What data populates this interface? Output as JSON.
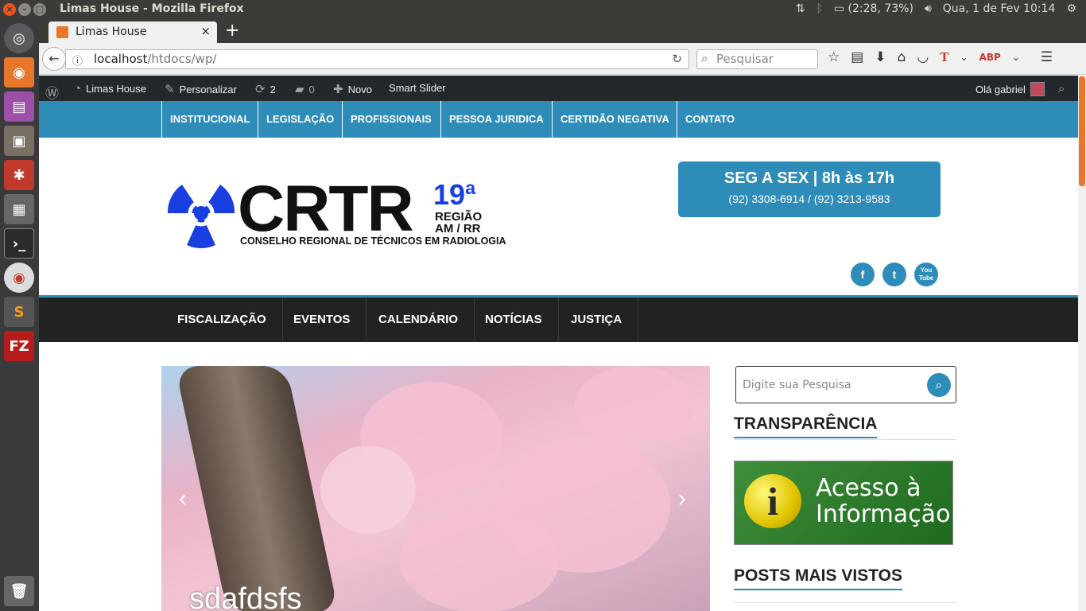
{
  "os": {
    "window_title": "Limas House - Mozilla Firefox",
    "battery": "(2:28, 73%)",
    "datetime": "Qua,  1 de Fev 10:14"
  },
  "browser": {
    "tab_title": "Limas House",
    "url_host": "localhost",
    "url_path": "/htdocs/wp/",
    "search_placeholder": "Pesquisar"
  },
  "wp_admin": {
    "site_name": "Limas House",
    "customize": "Personalizar",
    "updates": "2",
    "comments": "0",
    "new": "Novo",
    "smart_slider": "Smart Slider",
    "greeting": "Olá gabriel"
  },
  "top_nav": [
    "INSTITUCIONAL",
    "LEGISLAÇÃO",
    "PROFISSIONAIS",
    "PESSOA JURIDICA",
    "CERTIDÃO NEGATIVA",
    "CONTATO"
  ],
  "logo": {
    "name": "CRTR",
    "region_number": "19ª",
    "region_label": "REGIÃO",
    "states": "AM / RR",
    "full_name": "CONSELHO REGIONAL DE TÉCNICOS EM RADIOLOGIA"
  },
  "hours": {
    "schedule": "SEG A SEX | 8h às 17h",
    "phones": "(92) 3308-6914 / (92) 3213-9583"
  },
  "social": {
    "facebook": "f",
    "twitter": "t",
    "youtube": "You Tube"
  },
  "main_nav": [
    "FISCALIZAÇÃO",
    "EVENTOS",
    "CALENDÁRIO",
    "NOTÍCIAS",
    "JUSTIÇA"
  ],
  "slider": {
    "caption": "sdafdsfs",
    "prev": "‹",
    "next": "›"
  },
  "sidebar": {
    "search_placeholder": "Digite sua Pesquisa",
    "transparency_title": "TRANSPARÊNCIA",
    "access_text_1": "Acesso à",
    "access_text_2": "Informação",
    "popular_title": "POSTS MAIS VISTOS"
  },
  "colors": {
    "primary": "#2e8cb8",
    "logo_blue": "#1a3fe0",
    "dark": "#222222"
  }
}
